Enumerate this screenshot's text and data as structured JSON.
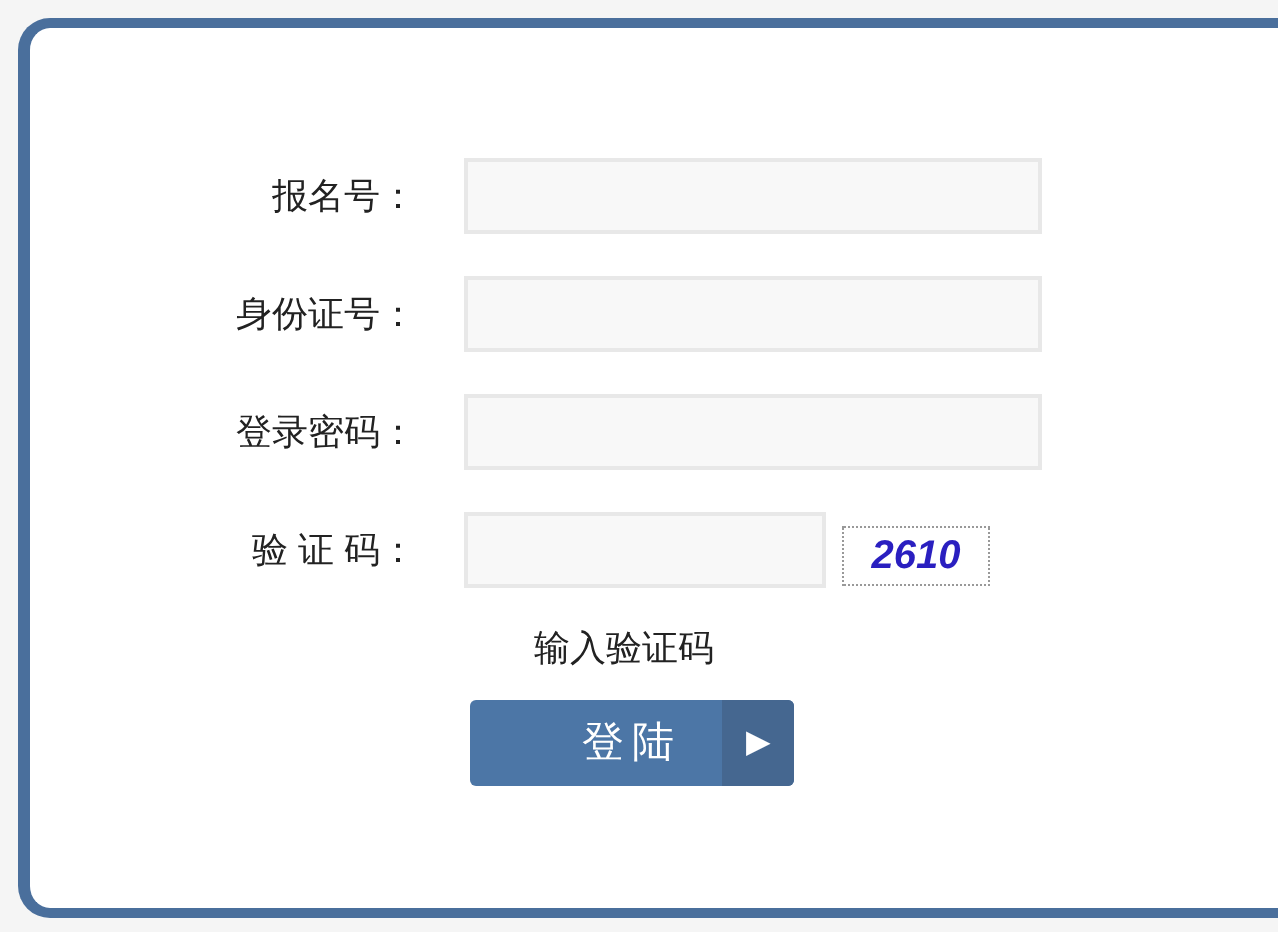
{
  "fields": [
    {
      "kind": "text",
      "label": "报名号："
    },
    {
      "kind": "text",
      "label": "身份证号："
    },
    {
      "kind": "password",
      "label": "登录密码："
    },
    {
      "kind": "captcha",
      "label": "验 证 码：",
      "captcha": "2610"
    }
  ],
  "captcha_hint": "输入验证码",
  "login_button": {
    "label": "登陆",
    "arrow": "▶"
  }
}
